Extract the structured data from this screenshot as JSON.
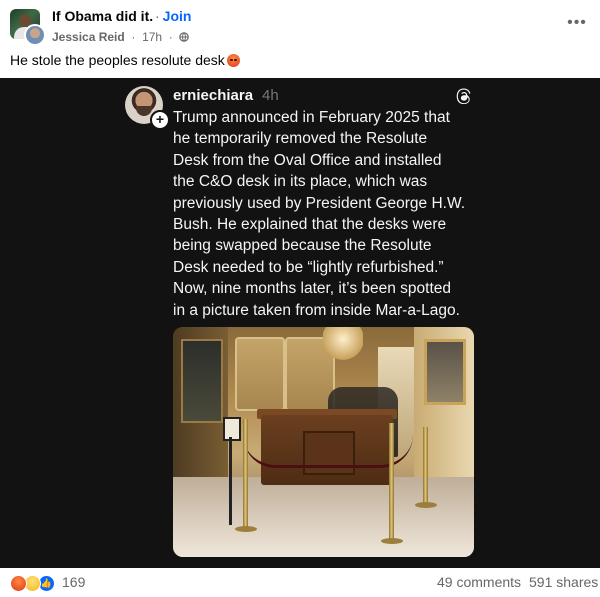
{
  "post": {
    "group_name": "If Obama did it.",
    "join_label": "Join",
    "author": "Jessica Reid",
    "time": "17h",
    "text": "He stole the peoples resolute desk",
    "more_label": "•••",
    "icons": {
      "more": "more-options-icon",
      "privacy": "globe-icon",
      "emoji": "angry-face-emoji"
    }
  },
  "shared": {
    "platform_icon": "threads-logo-icon",
    "username": "erniechiara",
    "time": "4h",
    "follow_icon": "+",
    "lines": [
      "Trump announced in February 2025 that",
      "he temporarily removed the Resolute",
      "Desk from the Oval Office and installed",
      "the C&O desk in its place, which was",
      "previously used by President George H.W.",
      "Bush. He explained that the desks were",
      "being swapped because the Resolute",
      "Desk needed to be “lightly refurbished.”",
      "Now, nine months later, it’s been spotted",
      "in a picture taken from inside Mar-a-Lago."
    ]
  },
  "footer": {
    "reaction_count": "169",
    "comments": "49 comments",
    "shares": "591 shares",
    "reactions": [
      "angry",
      "wow",
      "like"
    ]
  },
  "colors": {
    "accent": "#0866ff",
    "secondary_text": "#65676b",
    "media_bg": "#121212",
    "threads_text": "#f3f5f7"
  }
}
